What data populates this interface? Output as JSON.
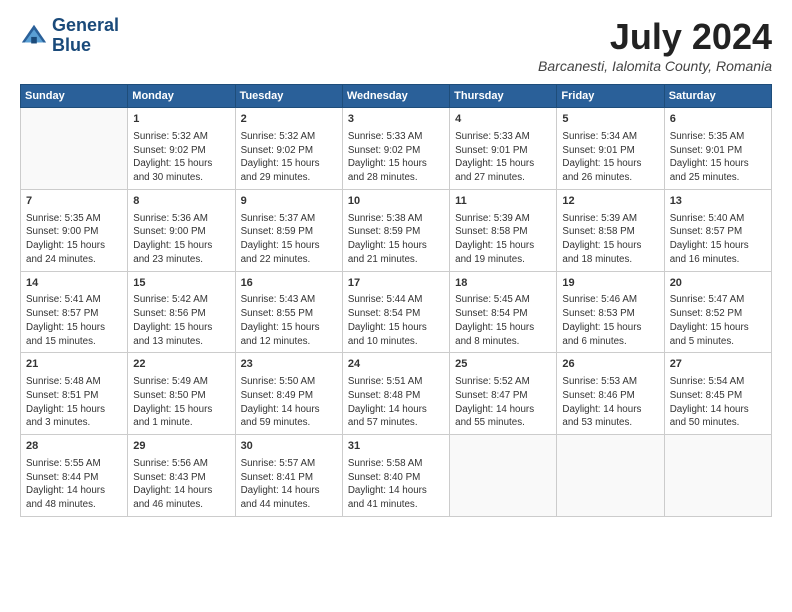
{
  "logo": {
    "line1": "General",
    "line2": "Blue"
  },
  "title": "July 2024",
  "subtitle": "Barcanesti, Ialomita County, Romania",
  "weekdays": [
    "Sunday",
    "Monday",
    "Tuesday",
    "Wednesday",
    "Thursday",
    "Friday",
    "Saturday"
  ],
  "weeks": [
    [
      {
        "day": "",
        "info": ""
      },
      {
        "day": "1",
        "info": "Sunrise: 5:32 AM\nSunset: 9:02 PM\nDaylight: 15 hours\nand 30 minutes."
      },
      {
        "day": "2",
        "info": "Sunrise: 5:32 AM\nSunset: 9:02 PM\nDaylight: 15 hours\nand 29 minutes."
      },
      {
        "day": "3",
        "info": "Sunrise: 5:33 AM\nSunset: 9:02 PM\nDaylight: 15 hours\nand 28 minutes."
      },
      {
        "day": "4",
        "info": "Sunrise: 5:33 AM\nSunset: 9:01 PM\nDaylight: 15 hours\nand 27 minutes."
      },
      {
        "day": "5",
        "info": "Sunrise: 5:34 AM\nSunset: 9:01 PM\nDaylight: 15 hours\nand 26 minutes."
      },
      {
        "day": "6",
        "info": "Sunrise: 5:35 AM\nSunset: 9:01 PM\nDaylight: 15 hours\nand 25 minutes."
      }
    ],
    [
      {
        "day": "7",
        "info": "Sunrise: 5:35 AM\nSunset: 9:00 PM\nDaylight: 15 hours\nand 24 minutes."
      },
      {
        "day": "8",
        "info": "Sunrise: 5:36 AM\nSunset: 9:00 PM\nDaylight: 15 hours\nand 23 minutes."
      },
      {
        "day": "9",
        "info": "Sunrise: 5:37 AM\nSunset: 8:59 PM\nDaylight: 15 hours\nand 22 minutes."
      },
      {
        "day": "10",
        "info": "Sunrise: 5:38 AM\nSunset: 8:59 PM\nDaylight: 15 hours\nand 21 minutes."
      },
      {
        "day": "11",
        "info": "Sunrise: 5:39 AM\nSunset: 8:58 PM\nDaylight: 15 hours\nand 19 minutes."
      },
      {
        "day": "12",
        "info": "Sunrise: 5:39 AM\nSunset: 8:58 PM\nDaylight: 15 hours\nand 18 minutes."
      },
      {
        "day": "13",
        "info": "Sunrise: 5:40 AM\nSunset: 8:57 PM\nDaylight: 15 hours\nand 16 minutes."
      }
    ],
    [
      {
        "day": "14",
        "info": "Sunrise: 5:41 AM\nSunset: 8:57 PM\nDaylight: 15 hours\nand 15 minutes."
      },
      {
        "day": "15",
        "info": "Sunrise: 5:42 AM\nSunset: 8:56 PM\nDaylight: 15 hours\nand 13 minutes."
      },
      {
        "day": "16",
        "info": "Sunrise: 5:43 AM\nSunset: 8:55 PM\nDaylight: 15 hours\nand 12 minutes."
      },
      {
        "day": "17",
        "info": "Sunrise: 5:44 AM\nSunset: 8:54 PM\nDaylight: 15 hours\nand 10 minutes."
      },
      {
        "day": "18",
        "info": "Sunrise: 5:45 AM\nSunset: 8:54 PM\nDaylight: 15 hours\nand 8 minutes."
      },
      {
        "day": "19",
        "info": "Sunrise: 5:46 AM\nSunset: 8:53 PM\nDaylight: 15 hours\nand 6 minutes."
      },
      {
        "day": "20",
        "info": "Sunrise: 5:47 AM\nSunset: 8:52 PM\nDaylight: 15 hours\nand 5 minutes."
      }
    ],
    [
      {
        "day": "21",
        "info": "Sunrise: 5:48 AM\nSunset: 8:51 PM\nDaylight: 15 hours\nand 3 minutes."
      },
      {
        "day": "22",
        "info": "Sunrise: 5:49 AM\nSunset: 8:50 PM\nDaylight: 15 hours\nand 1 minute."
      },
      {
        "day": "23",
        "info": "Sunrise: 5:50 AM\nSunset: 8:49 PM\nDaylight: 14 hours\nand 59 minutes."
      },
      {
        "day": "24",
        "info": "Sunrise: 5:51 AM\nSunset: 8:48 PM\nDaylight: 14 hours\nand 57 minutes."
      },
      {
        "day": "25",
        "info": "Sunrise: 5:52 AM\nSunset: 8:47 PM\nDaylight: 14 hours\nand 55 minutes."
      },
      {
        "day": "26",
        "info": "Sunrise: 5:53 AM\nSunset: 8:46 PM\nDaylight: 14 hours\nand 53 minutes."
      },
      {
        "day": "27",
        "info": "Sunrise: 5:54 AM\nSunset: 8:45 PM\nDaylight: 14 hours\nand 50 minutes."
      }
    ],
    [
      {
        "day": "28",
        "info": "Sunrise: 5:55 AM\nSunset: 8:44 PM\nDaylight: 14 hours\nand 48 minutes."
      },
      {
        "day": "29",
        "info": "Sunrise: 5:56 AM\nSunset: 8:43 PM\nDaylight: 14 hours\nand 46 minutes."
      },
      {
        "day": "30",
        "info": "Sunrise: 5:57 AM\nSunset: 8:41 PM\nDaylight: 14 hours\nand 44 minutes."
      },
      {
        "day": "31",
        "info": "Sunrise: 5:58 AM\nSunset: 8:40 PM\nDaylight: 14 hours\nand 41 minutes."
      },
      {
        "day": "",
        "info": ""
      },
      {
        "day": "",
        "info": ""
      },
      {
        "day": "",
        "info": ""
      }
    ]
  ]
}
